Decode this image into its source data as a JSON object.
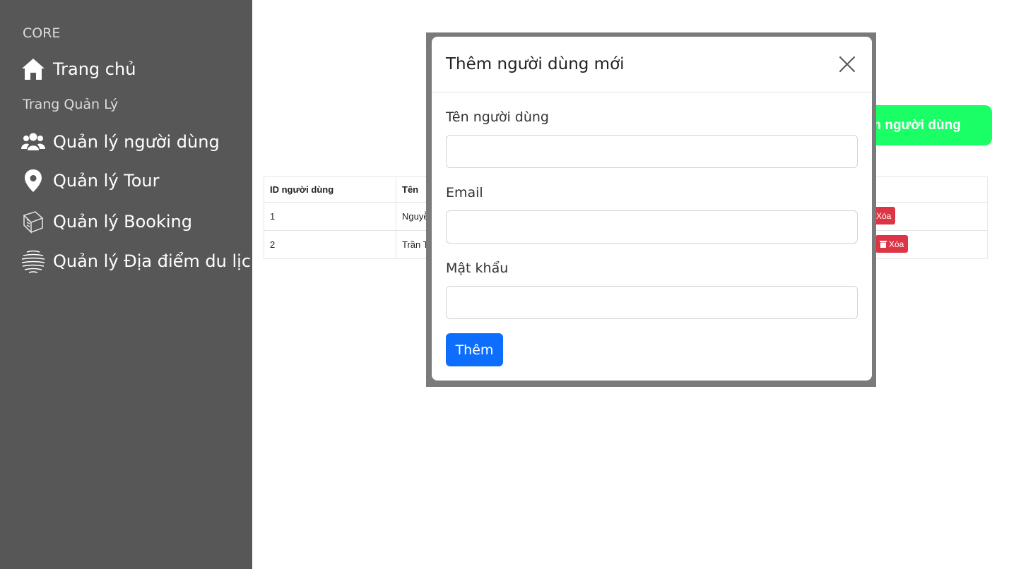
{
  "sidebar": {
    "section_core": "CORE",
    "home_label": "Trang chủ",
    "section_admin": "Trang Quản Lý",
    "items": [
      {
        "label": "Quản lý người dùng",
        "icon": "users-icon"
      },
      {
        "label": "Quản lý Tour",
        "icon": "map-pin-icon"
      },
      {
        "label": "Quản lý Booking",
        "icon": "book-icon"
      },
      {
        "label": "Quản lý Địa điểm du lịch",
        "icon": "globe-icon"
      }
    ]
  },
  "main": {
    "add_user_label": "hêm người dùng",
    "table": {
      "headers": [
        "ID người dùng",
        "Tên"
      ],
      "rows": [
        {
          "id": "1",
          "name": "Nguyễ"
        },
        {
          "id": "2",
          "name": "Trần T"
        }
      ],
      "delete_label": "Xóa"
    }
  },
  "modal": {
    "title": "Thêm người dùng mới",
    "fields": {
      "name_label": "Tên người dùng",
      "email_label": "Email",
      "password_label": "Mật khẩu"
    },
    "submit_label": "Thêm"
  },
  "colors": {
    "sidebar_bg": "#575757",
    "add_button": "#1aff66",
    "primary": "#0d6efd",
    "danger": "#dc3545"
  }
}
